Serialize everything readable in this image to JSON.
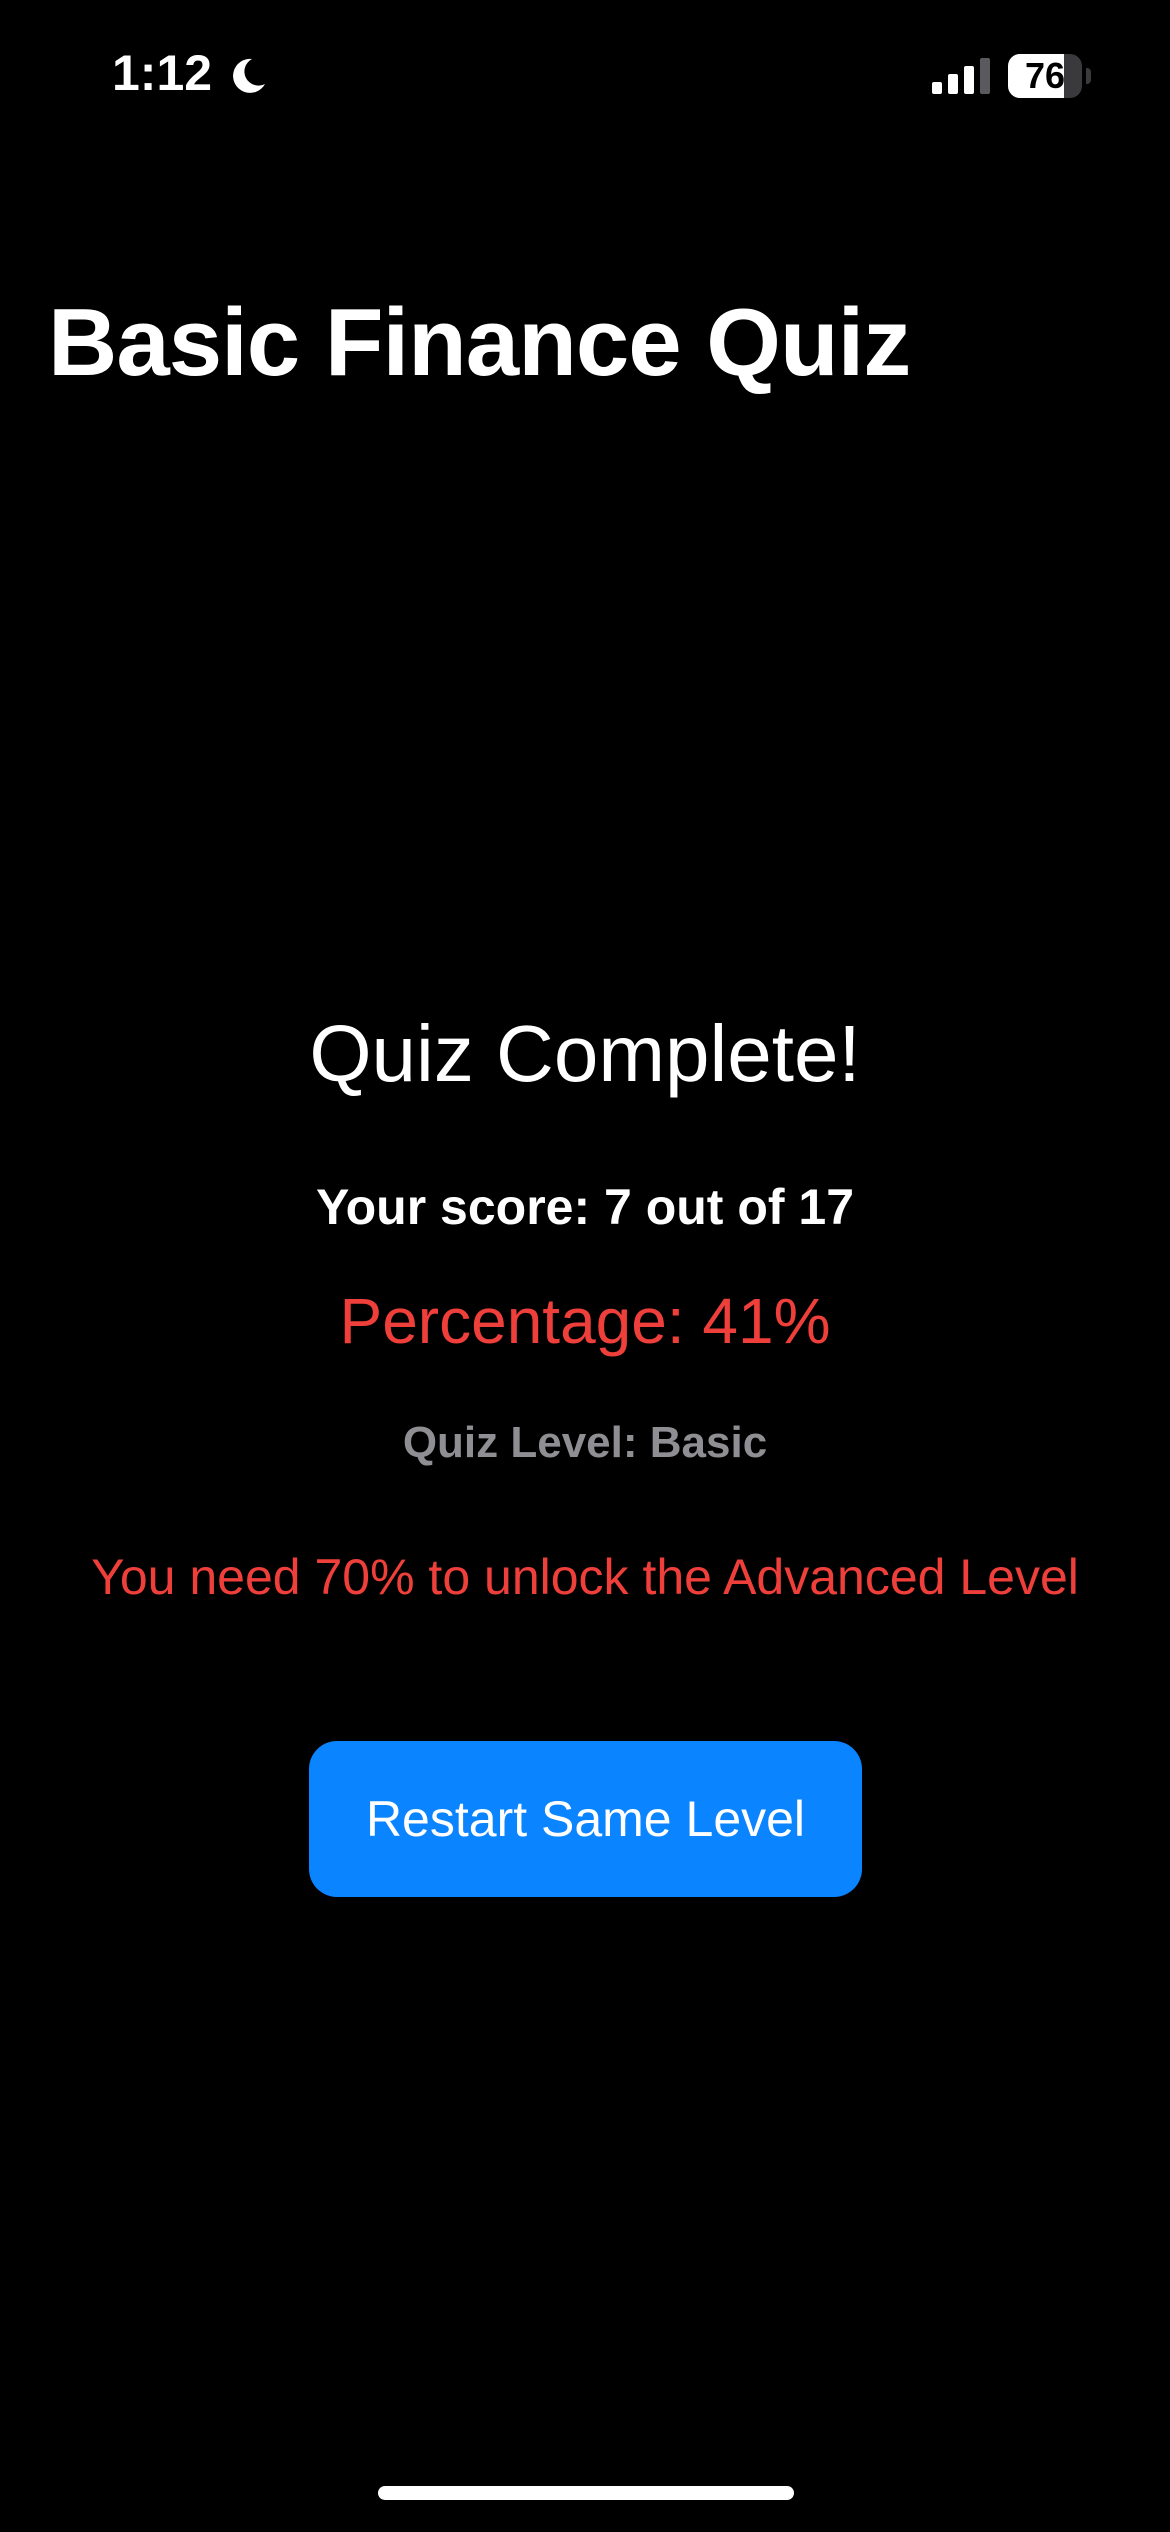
{
  "status_bar": {
    "time": "1:12",
    "battery_level": 76,
    "battery_label": "76",
    "icons": [
      "moon-icon",
      "cellular-signal-icon",
      "battery-icon"
    ]
  },
  "header": {
    "title": "Basic Finance Quiz"
  },
  "results": {
    "heading": "Quiz Complete!",
    "score": "Your score: 7 out of 17",
    "percentage": "Percentage: 41%",
    "level": "Quiz Level: Basic",
    "unlock_message": "You need 70% to unlock the Advanced Level"
  },
  "actions": {
    "restart_label": "Restart Same Level"
  },
  "colors": {
    "background": "#000000",
    "text_primary": "#ffffff",
    "text_secondary": "#8e8e93",
    "alert_red": "#ef3f3a",
    "accent_blue": "#0a84ff"
  }
}
